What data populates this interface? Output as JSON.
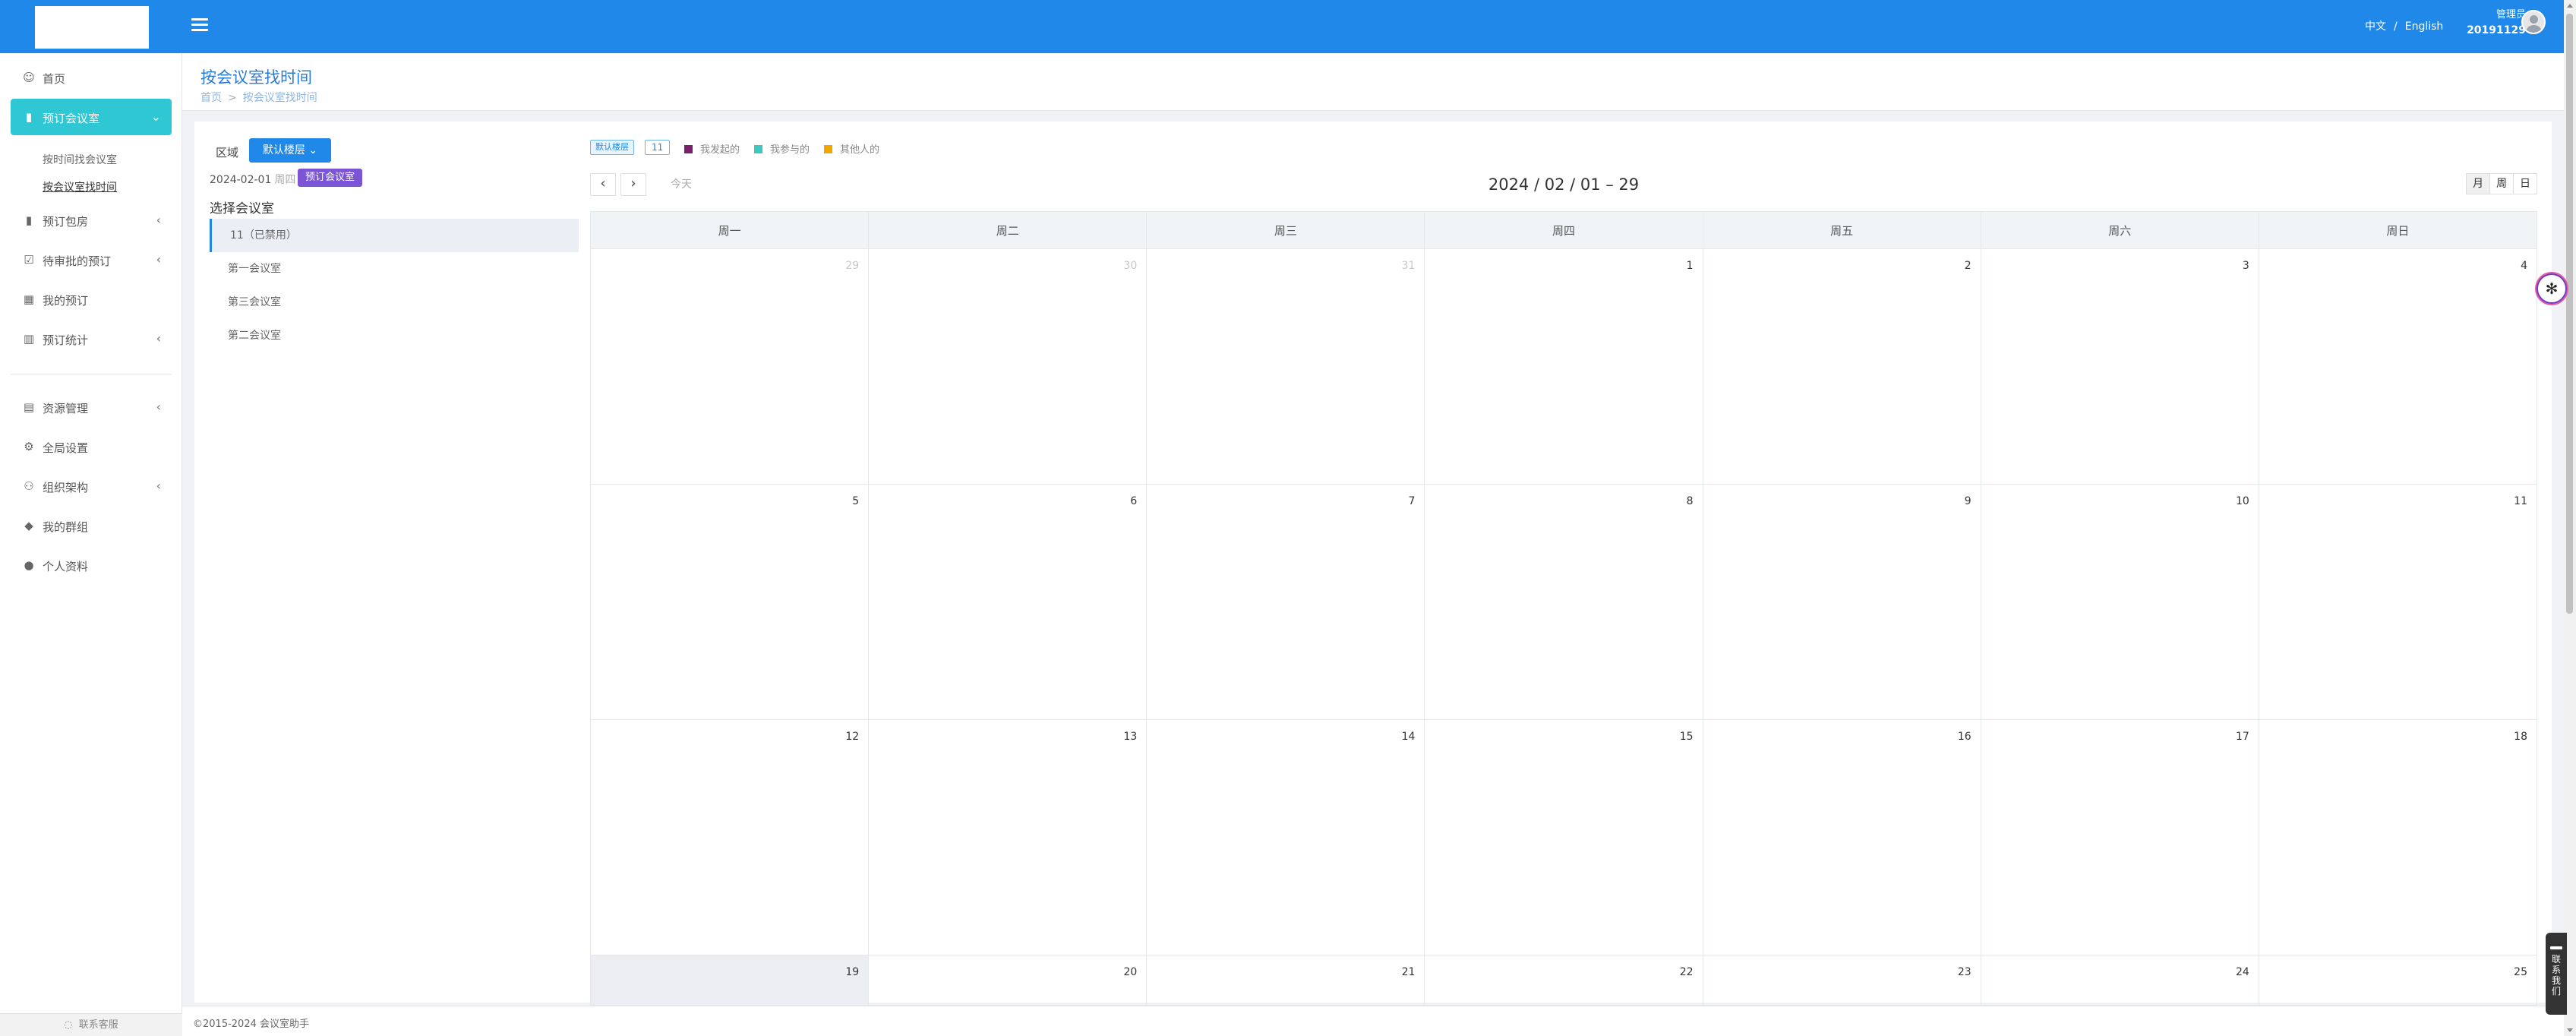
{
  "header": {
    "lang_zh": "中文",
    "lang_sep": "/",
    "lang_en": "English",
    "user_role": "管理员",
    "user_id": "20191129",
    "brand_color": "#2088e8"
  },
  "sidebar": {
    "items": [
      {
        "label": "首页",
        "icon": "home-icon"
      },
      {
        "label": "预订会议室",
        "icon": "book-icon"
      },
      {
        "label": "预订包房",
        "icon": "room-icon"
      },
      {
        "label": "待审批的预订",
        "icon": "approval-icon"
      },
      {
        "label": "我的预订",
        "icon": "calendar-icon"
      },
      {
        "label": "预订统计",
        "icon": "chart-icon"
      },
      {
        "label": "资源管理",
        "icon": "building-icon"
      },
      {
        "label": "全局设置",
        "icon": "gear-icon"
      },
      {
        "label": "组织架构",
        "icon": "org-icon"
      },
      {
        "label": "我的群组",
        "icon": "tags-icon"
      },
      {
        "label": "个人资料",
        "icon": "user-icon"
      }
    ],
    "sub_items": [
      "按时间找会议室",
      "按会议室找时间"
    ],
    "footer": "联系客服",
    "active_color": "#2ec7d3"
  },
  "page": {
    "title": "按会议室找时间",
    "breadcrumb_home": "首页",
    "breadcrumb_current": "按会议室找时间"
  },
  "left_panel": {
    "area_label": "区域",
    "area_value": "默认楼层",
    "date": "2024-02-01",
    "weekday": "周四",
    "book_button": "预订会议室",
    "room_title": "选择会议室",
    "rooms": [
      "11（已禁用）",
      "第一会议室",
      "第三会议室",
      "第二会议室"
    ]
  },
  "calendar": {
    "tag_default": "默认楼层",
    "tag_count": "11",
    "legend": [
      {
        "label": "我发起的",
        "color": "#7a1f6e"
      },
      {
        "label": "我参与的",
        "color": "#3ec9c0"
      },
      {
        "label": "其他人的",
        "color": "#f0a500"
      }
    ],
    "today_label": "今天",
    "title": "2024 / 02 / 01 – 29",
    "views": [
      "月",
      "周",
      "日"
    ],
    "weekdays": [
      "周一",
      "周二",
      "周三",
      "周四",
      "周五",
      "周六",
      "周日"
    ],
    "weeks": [
      [
        "29",
        "30",
        "31",
        "1",
        "2",
        "3",
        "4"
      ],
      [
        "5",
        "6",
        "7",
        "8",
        "9",
        "10",
        "11"
      ],
      [
        "12",
        "13",
        "14",
        "15",
        "16",
        "17",
        "18"
      ],
      [
        "19",
        "20",
        "21",
        "22",
        "23",
        "24",
        "25"
      ]
    ]
  },
  "footer": {
    "copyright": "©2015-2024 会议室助手"
  },
  "widgets": {
    "side_tab": "联系我们"
  }
}
